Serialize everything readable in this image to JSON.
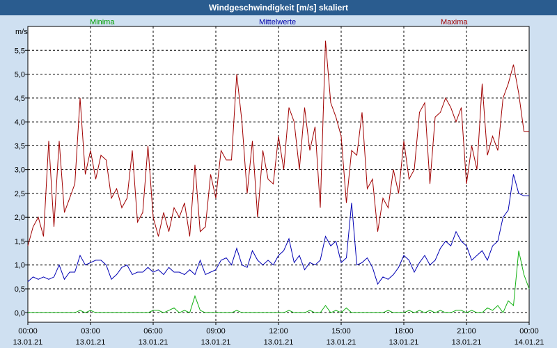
{
  "title": "Windgeschwindigkeit [m/s] skaliert",
  "legend": {
    "min": "Minima",
    "avg": "Mittelwerte",
    "max": "Maxima"
  },
  "colors": {
    "background": "#cfe0f1",
    "title_bar": "#2a5c8f",
    "plot_bg": "#ffffff",
    "min": "#10b010",
    "avg": "#0000b4",
    "max": "#a00000"
  },
  "chart_data": {
    "type": "line",
    "title": "Windgeschwindigkeit [m/s] skaliert",
    "ylabel": "m/s",
    "ylim": [
      -0.2,
      6.0
    ],
    "xlim": [
      0,
      24
    ],
    "y_ticks": [
      "0,0",
      "0,5",
      "1,0",
      "1,5",
      "2,0",
      "2,5",
      "3,0",
      "3,5",
      "4,0",
      "4,5",
      "5,0",
      "5,5"
    ],
    "y_tick_values": [
      0,
      0.5,
      1.0,
      1.5,
      2.0,
      2.5,
      3.0,
      3.5,
      4.0,
      4.5,
      5.0,
      5.5
    ],
    "x_ticks": [
      {
        "h": 0,
        "time": "00:00",
        "date": "13.01.21"
      },
      {
        "h": 3,
        "time": "03:00",
        "date": "13.01.21"
      },
      {
        "h": 6,
        "time": "06:00",
        "date": "13.01.21"
      },
      {
        "h": 9,
        "time": "09:00",
        "date": "13.01.21"
      },
      {
        "h": 12,
        "time": "12:00",
        "date": "13.01.21"
      },
      {
        "h": 15,
        "time": "15:00",
        "date": "13.01.21"
      },
      {
        "h": 18,
        "time": "18:00",
        "date": "13.01.21"
      },
      {
        "h": 21,
        "time": "21:00",
        "date": "13.01.21"
      },
      {
        "h": 24,
        "time": "00:00",
        "date": "14.01.21"
      }
    ],
    "grid": true,
    "series": [
      {
        "name": "Maxima",
        "x": [
          0,
          0.25,
          0.5,
          0.75,
          1,
          1.25,
          1.5,
          1.75,
          2,
          2.25,
          2.5,
          2.75,
          3,
          3.25,
          3.5,
          3.75,
          4,
          4.25,
          4.5,
          4.75,
          5,
          5.25,
          5.5,
          5.75,
          6,
          6.25,
          6.5,
          6.75,
          7,
          7.25,
          7.5,
          7.75,
          8,
          8.25,
          8.5,
          8.75,
          9,
          9.25,
          9.5,
          9.75,
          10,
          10.25,
          10.5,
          10.75,
          11,
          11.25,
          11.5,
          11.75,
          12,
          12.25,
          12.5,
          12.75,
          13,
          13.25,
          13.5,
          13.75,
          14,
          14.25,
          14.5,
          14.75,
          15,
          15.25,
          15.5,
          15.75,
          16,
          16.25,
          16.5,
          16.75,
          17,
          17.25,
          17.5,
          17.75,
          18,
          18.25,
          18.5,
          18.75,
          19,
          19.25,
          19.5,
          19.75,
          20,
          20.25,
          20.5,
          20.75,
          21,
          21.25,
          21.5,
          21.75,
          22,
          22.25,
          22.5,
          22.75,
          23,
          23.25,
          23.5,
          23.75,
          24
        ],
        "values": [
          1.4,
          1.8,
          2.0,
          1.6,
          3.6,
          1.8,
          3.6,
          2.1,
          2.4,
          2.7,
          4.5,
          2.9,
          3.4,
          2.8,
          3.3,
          3.2,
          2.4,
          2.6,
          2.2,
          2.4,
          3.4,
          1.9,
          2.1,
          3.5,
          2.0,
          1.6,
          2.1,
          1.7,
          2.2,
          2.0,
          2.3,
          1.6,
          3.1,
          1.7,
          1.8,
          2.9,
          2.4,
          3.4,
          3.2,
          3.2,
          5.0,
          4.0,
          2.5,
          3.6,
          2.0,
          3.4,
          2.8,
          2.7,
          3.7,
          3.0,
          4.3,
          4.0,
          3.0,
          4.3,
          3.4,
          3.9,
          2.2,
          5.7,
          4.4,
          4.1,
          3.7,
          2.3,
          3.4,
          3.3,
          4.2,
          2.6,
          2.8,
          1.7,
          2.4,
          2.2,
          3.0,
          2.5,
          3.6,
          2.8,
          3.0,
          4.2,
          4.4,
          2.7,
          4.1,
          4.2,
          4.5,
          4.3,
          4.0,
          4.3,
          2.7,
          3.5,
          3.0,
          4.8,
          3.3,
          3.7,
          3.4,
          4.5,
          4.8,
          5.2,
          4.6,
          3.8,
          3.8
        ],
        "color": "#a00000"
      },
      {
        "name": "Mittelwerte",
        "x": [
          0,
          0.25,
          0.5,
          0.75,
          1,
          1.25,
          1.5,
          1.75,
          2,
          2.25,
          2.5,
          2.75,
          3,
          3.25,
          3.5,
          3.75,
          4,
          4.25,
          4.5,
          4.75,
          5,
          5.25,
          5.5,
          5.75,
          6,
          6.25,
          6.5,
          6.75,
          7,
          7.25,
          7.5,
          7.75,
          8,
          8.25,
          8.5,
          8.75,
          9,
          9.25,
          9.5,
          9.75,
          10,
          10.25,
          10.5,
          10.75,
          11,
          11.25,
          11.5,
          11.75,
          12,
          12.25,
          12.5,
          12.75,
          13,
          13.25,
          13.5,
          13.75,
          14,
          14.25,
          14.5,
          14.75,
          15,
          15.25,
          15.5,
          15.75,
          16,
          16.25,
          16.5,
          16.75,
          17,
          17.25,
          17.5,
          17.75,
          18,
          18.25,
          18.5,
          18.75,
          19,
          19.25,
          19.5,
          19.75,
          20,
          20.25,
          20.5,
          20.75,
          21,
          21.25,
          21.5,
          21.75,
          22,
          22.25,
          22.5,
          22.75,
          23,
          23.25,
          23.5,
          23.75,
          24
        ],
        "values": [
          0.65,
          0.75,
          0.7,
          0.75,
          0.7,
          0.75,
          1.0,
          0.7,
          0.85,
          0.85,
          1.2,
          1.0,
          1.05,
          1.1,
          1.1,
          1.0,
          0.7,
          0.8,
          0.95,
          1.0,
          0.8,
          0.85,
          0.85,
          0.95,
          0.85,
          0.9,
          0.8,
          0.95,
          0.85,
          0.85,
          0.8,
          0.9,
          0.8,
          1.1,
          0.8,
          0.85,
          0.9,
          1.1,
          1.15,
          1.0,
          1.35,
          1.0,
          0.95,
          1.3,
          1.1,
          1.0,
          1.1,
          1.0,
          1.2,
          1.3,
          1.55,
          1.05,
          1.2,
          0.9,
          1.05,
          1.0,
          1.1,
          1.6,
          1.4,
          1.5,
          1.05,
          1.15,
          2.3,
          1.0,
          1.05,
          1.15,
          0.95,
          0.6,
          0.75,
          0.7,
          0.8,
          0.95,
          1.2,
          1.1,
          0.85,
          1.05,
          1.2,
          1.0,
          1.1,
          1.35,
          1.5,
          1.4,
          1.7,
          1.5,
          1.4,
          1.1,
          1.2,
          1.3,
          1.1,
          1.4,
          1.5,
          2.0,
          2.15,
          2.9,
          2.5,
          2.45,
          2.45
        ],
        "color": "#0000b4"
      },
      {
        "name": "Minima",
        "x": [
          0,
          0.25,
          0.5,
          0.75,
          1,
          1.25,
          1.5,
          1.75,
          2,
          2.25,
          2.5,
          2.75,
          3,
          3.25,
          3.5,
          3.75,
          4,
          4.25,
          4.5,
          4.75,
          5,
          5.25,
          5.5,
          5.75,
          6,
          6.25,
          6.5,
          6.75,
          7,
          7.25,
          7.5,
          7.75,
          8,
          8.25,
          8.5,
          8.75,
          9,
          9.25,
          9.5,
          9.75,
          10,
          10.25,
          10.5,
          10.75,
          11,
          11.25,
          11.5,
          11.75,
          12,
          12.25,
          12.5,
          12.75,
          13,
          13.25,
          13.5,
          13.75,
          14,
          14.25,
          14.5,
          14.75,
          15,
          15.25,
          15.5,
          15.75,
          16,
          16.25,
          16.5,
          16.75,
          17,
          17.25,
          17.5,
          17.75,
          18,
          18.25,
          18.5,
          18.75,
          19,
          19.25,
          19.5,
          19.75,
          20,
          20.25,
          20.5,
          20.75,
          21,
          21.25,
          21.5,
          21.75,
          22,
          22.25,
          22.5,
          22.75,
          23,
          23.25,
          23.5,
          23.75,
          24
        ],
        "values": [
          0,
          0,
          0,
          0,
          0,
          0,
          0,
          0,
          0,
          0,
          0.05,
          0,
          0.05,
          0,
          0,
          0,
          0,
          0,
          0,
          0,
          0,
          0,
          0,
          0,
          0.05,
          0.05,
          0,
          0.05,
          0.1,
          0,
          0.05,
          0,
          0.35,
          0.05,
          0,
          0,
          0,
          0,
          0,
          0,
          0.05,
          0,
          0,
          0,
          0,
          0,
          0,
          0,
          0,
          0,
          0.05,
          0,
          0,
          0,
          0.05,
          0,
          0,
          0.15,
          0,
          0.05,
          0,
          0.1,
          0,
          0,
          0,
          0,
          0,
          0,
          0,
          0.05,
          0,
          0,
          0,
          0.05,
          0,
          0.05,
          0,
          0.05,
          0,
          0.05,
          0,
          0,
          0.05,
          0.05,
          0,
          0.05,
          0,
          0,
          0.1,
          0.05,
          0.15,
          0,
          0.25,
          0.15,
          1.3,
          0.8,
          0.5
        ],
        "color": "#10b010"
      }
    ]
  }
}
